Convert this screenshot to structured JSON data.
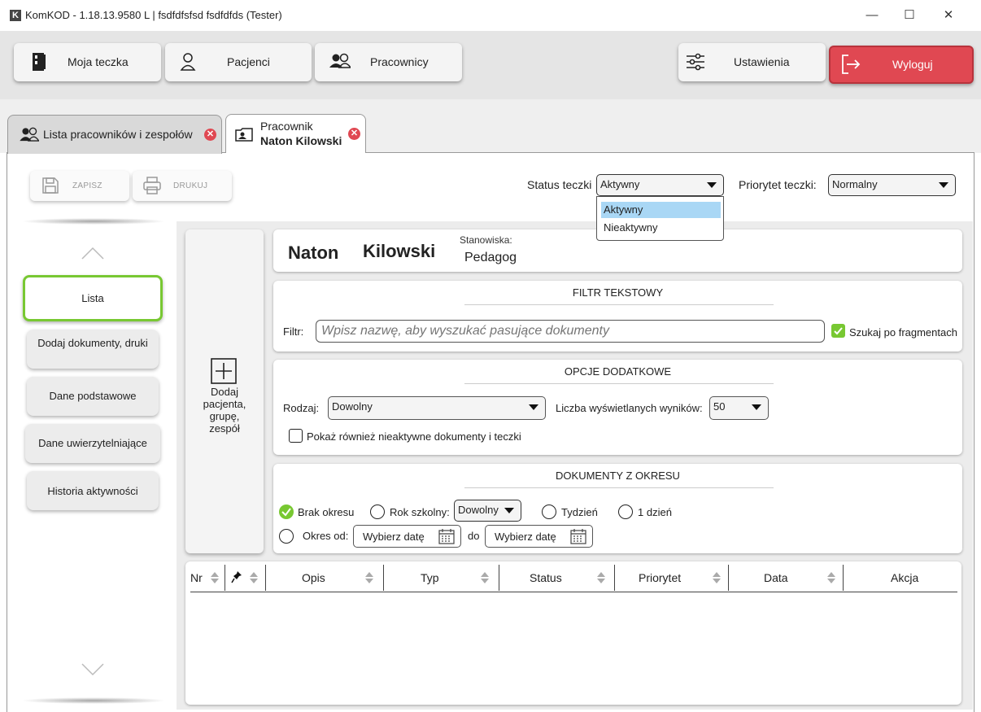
{
  "window": {
    "logo_letter": "K",
    "title": "KomKOD - 1.18.13.9580 L | fsdfdfsfsd fsdfdfds (Tester)",
    "minimize_glyph": "—",
    "maximize_glyph": "☐",
    "close_glyph": "✕"
  },
  "topnav": {
    "my_folder": "Moja teczka",
    "patients": "Pacjenci",
    "employees": "Pracownicy",
    "settings": "Ustawienia",
    "logout": "Wyloguj"
  },
  "tabs": {
    "list_tab": "Lista pracowników i zespołów",
    "employee_tab_line1": "Pracownik",
    "employee_tab_line2": "Naton Kilowski"
  },
  "toolbar": {
    "save": "ZAPISZ",
    "print": "DRUKUJ",
    "status_label": "Status teczki",
    "status_value": "Aktywny",
    "status_options": [
      "Aktywny",
      "Nieaktywny"
    ],
    "priority_label": "Priorytet teczki:",
    "priority_value": "Normalny"
  },
  "sidebar": {
    "items": [
      "Lista",
      "Dodaj dokumenty, druki",
      "Dane podstawowe",
      "Dane uwierzytelniające",
      "Historia aktywności"
    ]
  },
  "add_button": {
    "line1": "Dodaj",
    "line2": "pacjenta,",
    "line3": "grupę,",
    "line4": "zespół"
  },
  "employee": {
    "first_name": "Naton",
    "last_name": "Kilowski",
    "positions_label": "Stanowiska:",
    "position": "Pedagog"
  },
  "filter_panel": {
    "title": "FILTR TEKSTOWY",
    "filter_label": "Filtr:",
    "filter_placeholder": "Wpisz nazwę, aby wyszukać pasujące dokumenty",
    "fragments_label": "Szukaj po fragmentach",
    "fragments_checked": true
  },
  "options_panel": {
    "title": "OPCJE DODATKOWE",
    "type_label": "Rodzaj:",
    "type_value": "Dowolny",
    "results_label": "Liczba wyświetlanych wyników:",
    "results_value": "50",
    "inactive_label": "Pokaż również nieaktywne dokumenty i teczki",
    "inactive_checked": false
  },
  "period_panel": {
    "title": "DOKUMENTY Z OKRESU",
    "no_period": "Brak okresu",
    "school_year": "Rok szkolny:",
    "school_year_value": "Dowolny",
    "week": "Tydzień",
    "one_day": "1 dzień",
    "period_from": "Okres od:",
    "choose_date_1": "Wybierz datę",
    "to": "do",
    "choose_date_2": "Wybierz datę",
    "selected": "Brak okresu"
  },
  "table": {
    "columns": [
      "Nr",
      "Opis",
      "Typ",
      "Status",
      "Priorytet",
      "Data",
      "Akcja"
    ]
  },
  "colors": {
    "accent_green": "#78c832",
    "logout_red": "#e04852",
    "dropdown_highlight": "#a9d7f5"
  }
}
